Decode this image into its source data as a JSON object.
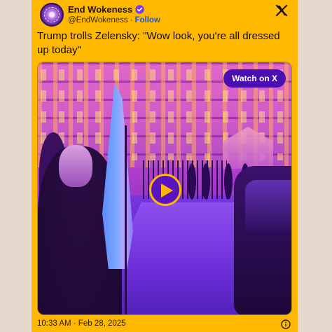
{
  "author": {
    "display_name": "End Wokeness",
    "handle": "@EndWokeness",
    "separator": "·",
    "follow_label": "Follow"
  },
  "tweet": {
    "text": "Trump trolls Zelensky: \"Wow look, you're all dressed up today\""
  },
  "media": {
    "watch_label": "Watch on X"
  },
  "footer": {
    "timestamp": "10:33 AM · Feb 28, 2025"
  },
  "colors": {
    "card_bg": "#ffb800",
    "page_bg": "#e4d9cc",
    "watch_button": "#4a0fb0",
    "verified": "#7a3be0"
  },
  "icons": [
    "avatar",
    "verified-icon",
    "x-logo-icon",
    "play-icon",
    "info-icon"
  ]
}
